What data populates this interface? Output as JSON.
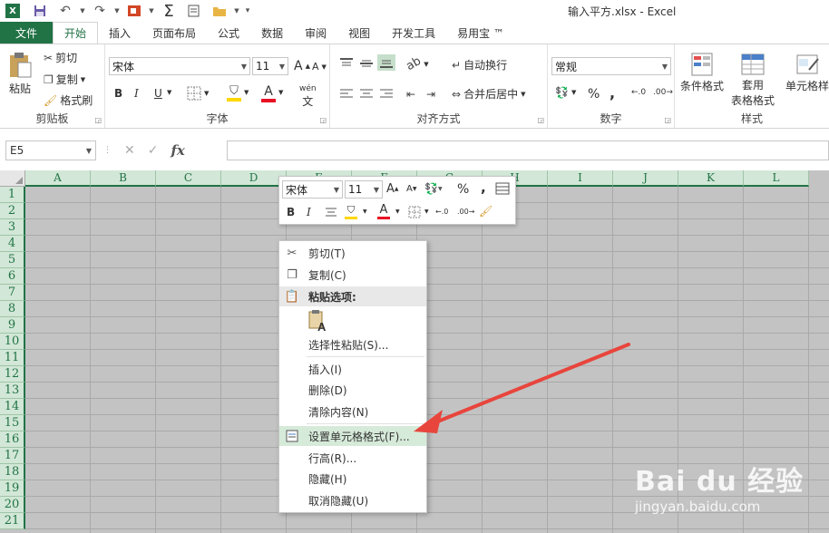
{
  "window": {
    "title": "输入平方.xlsx - Excel"
  },
  "qat": {
    "app_logo_text": "X",
    "sum_symbol": "Σ"
  },
  "tabs": [
    {
      "label": "文件"
    },
    {
      "label": "开始"
    },
    {
      "label": "插入"
    },
    {
      "label": "页面布局"
    },
    {
      "label": "公式"
    },
    {
      "label": "数据"
    },
    {
      "label": "审阅"
    },
    {
      "label": "视图"
    },
    {
      "label": "开发工具"
    },
    {
      "label": "易用宝 ™"
    }
  ],
  "ribbon": {
    "clipboard": {
      "paste": "粘贴",
      "cut": "剪切",
      "copy": "复制",
      "format_painter": "格式刷",
      "label": "剪贴板"
    },
    "font": {
      "font_name": "宋体",
      "font_size": "11",
      "grow": "A",
      "shrink": "A",
      "bold": "B",
      "italic": "I",
      "underline": "U",
      "wen": "wén",
      "label": "字体",
      "fill_color": "#ffd700",
      "font_color": "#e81123"
    },
    "alignment": {
      "wrap_text": "自动换行",
      "merge_center": "合并后居中",
      "label": "对齐方式"
    },
    "number": {
      "format": "常规",
      "percent": "%",
      "comma": ",",
      "label": "数字"
    },
    "styles": {
      "conditional": "条件格式",
      "table1": "套用",
      "table2": "表格格式",
      "cell_styles": "单元格样",
      "label": "样式"
    }
  },
  "formula_bar": {
    "name_box": "E5",
    "fx": "fx",
    "value": ""
  },
  "grid": {
    "columns": [
      "A",
      "B",
      "C",
      "D",
      "E",
      "F",
      "G",
      "H",
      "I",
      "J",
      "K",
      "L"
    ],
    "rows": [
      "1",
      "2",
      "3",
      "4",
      "5",
      "6",
      "7",
      "8",
      "9",
      "10",
      "11",
      "12",
      "13",
      "14",
      "15",
      "16",
      "17",
      "18",
      "19",
      "20",
      "21"
    ],
    "header_color": "#217346"
  },
  "mini_toolbar": {
    "font_name": "宋体",
    "font_size": "11",
    "bold": "B",
    "italic": "I",
    "percent": "%",
    "comma": ","
  },
  "context_menu": {
    "cut": "剪切(T)",
    "copy": "复制(C)",
    "paste_options": "粘贴选项:",
    "paste_special": "选择性粘贴(S)...",
    "insert": "插入(I)",
    "delete": "删除(D)",
    "clear_contents": "清除内容(N)",
    "format_cells": "设置单元格格式(F)...",
    "row_height": "行高(R)...",
    "hide": "隐藏(H)",
    "unhide": "取消隐藏(U)"
  },
  "annotation": {
    "arrow_color": "#e8453c"
  },
  "watermark": {
    "brand": "Bai du 经验",
    "url": "jingyan.baidu.com"
  }
}
